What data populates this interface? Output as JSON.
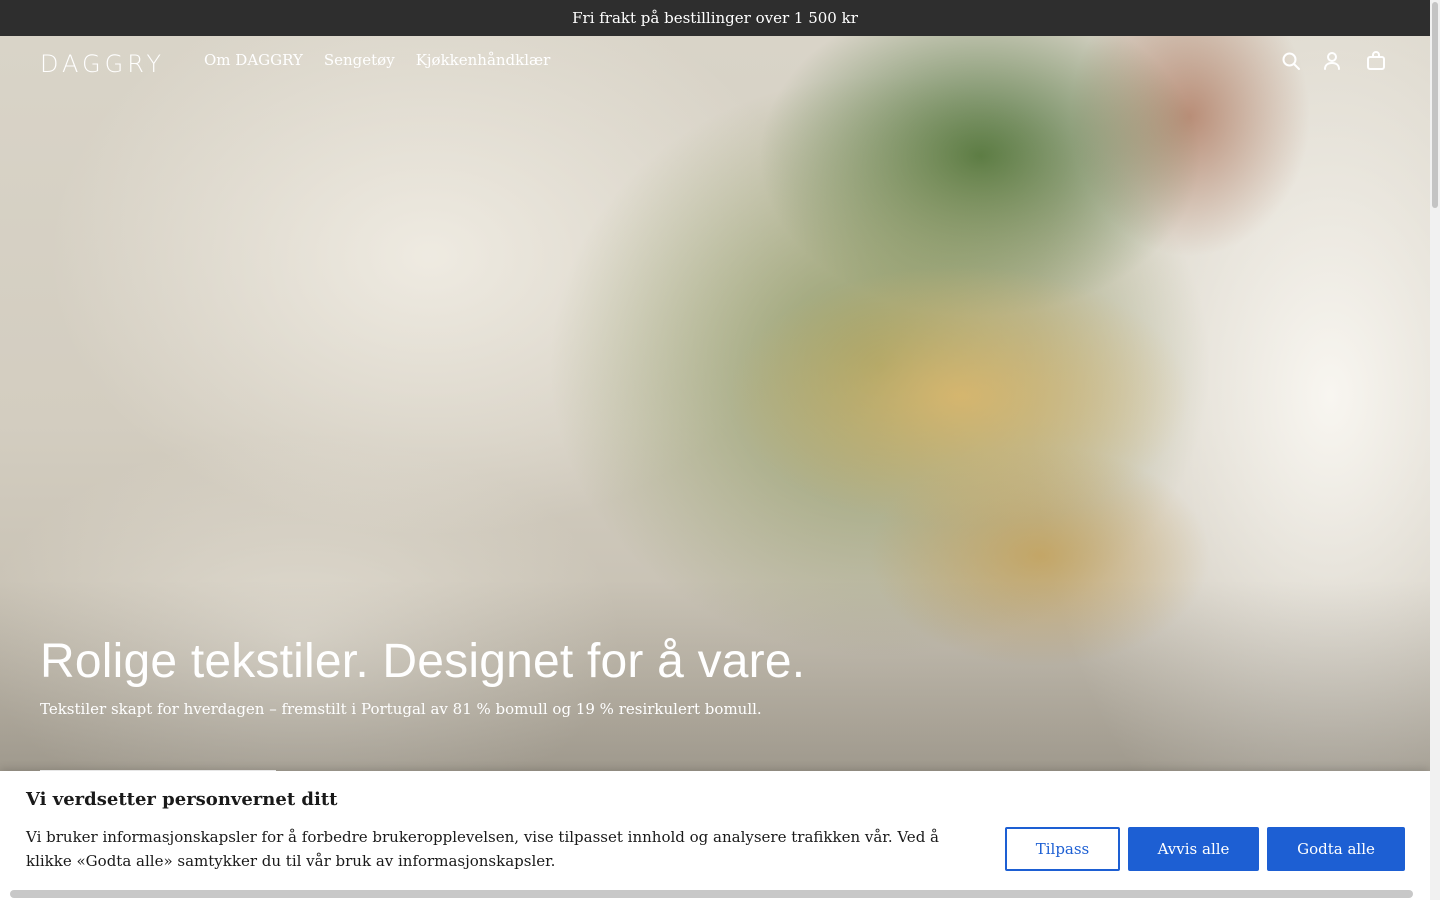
{
  "announcement": {
    "text": "Fri frakt på bestillinger over 1 500 kr"
  },
  "header": {
    "logo": "DAGGRY",
    "nav": [
      {
        "label": "Om DAGGRY"
      },
      {
        "label": "Sengetøy"
      },
      {
        "label": "Kjøkkenhåndklær"
      }
    ],
    "icons": [
      "search-icon",
      "account-icon",
      "cart-icon"
    ]
  },
  "hero": {
    "title": "Rolige tekstiler. Designet for å vare.",
    "subtitle": "Tekstiler skapt for hverdagen – fremstilt i Portugal av 81 % bomull og 19 % resirkulert bomull."
  },
  "cookie_banner": {
    "title": "Vi verdsetter personvernet ditt",
    "text": "Vi bruker informasjonskapsler for å forbedre brukeropplevelsen, vise tilpasset innhold og analysere trafikken vår. Ved å klikke «Godta alle» samtykker du til vår bruk av informasjonskapsler.",
    "customize_label": "Tilpass",
    "reject_label": "Avvis alle",
    "accept_label": "Godta alle",
    "accent_color": "#1d5fd3"
  }
}
